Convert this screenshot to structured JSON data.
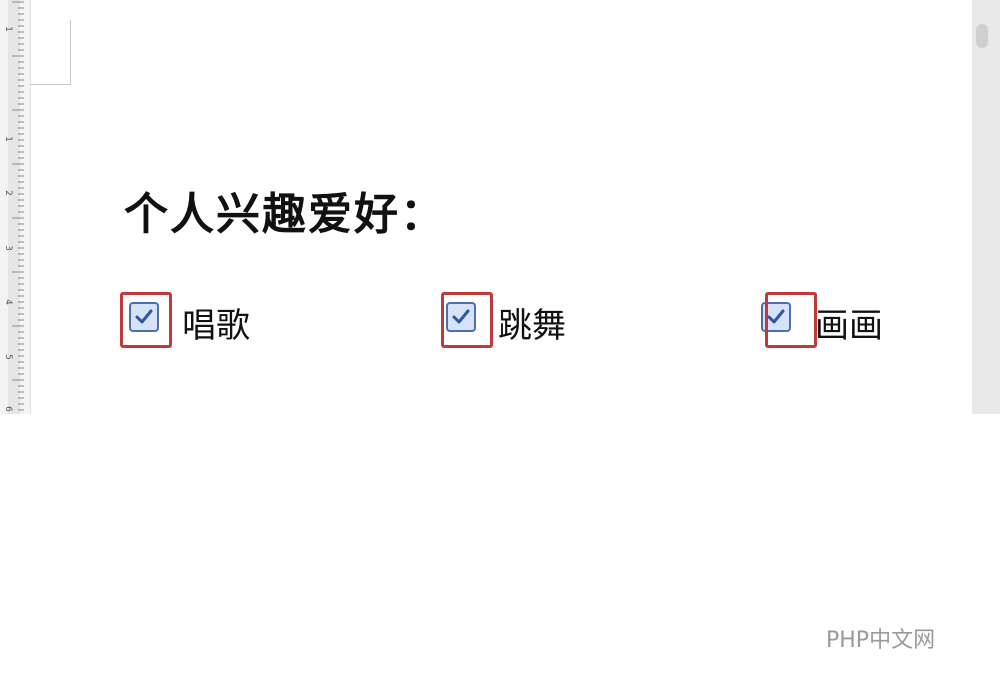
{
  "document": {
    "heading": "个人兴趣爱好：",
    "options": [
      {
        "label": "唱歌",
        "checked": true,
        "highlighted": true
      },
      {
        "label": "跳舞",
        "checked": true,
        "highlighted": true
      },
      {
        "label": "画画",
        "checked": true,
        "highlighted": true
      }
    ]
  },
  "ruler": {
    "numbers": [
      "1",
      "1",
      "2",
      "3",
      "4",
      "5",
      "6"
    ]
  },
  "watermark": {
    "text": "PHP中文网"
  },
  "colors": {
    "highlight_box": "#c0393b",
    "checkbox_border": "#4d6fb0",
    "checkbox_fill": "#d5e2f7",
    "checkmark": "#2f55a4"
  },
  "icons": {
    "checkbox": "checkbox-checked-icon",
    "scroll_thumb": "scrollbar-thumb"
  }
}
